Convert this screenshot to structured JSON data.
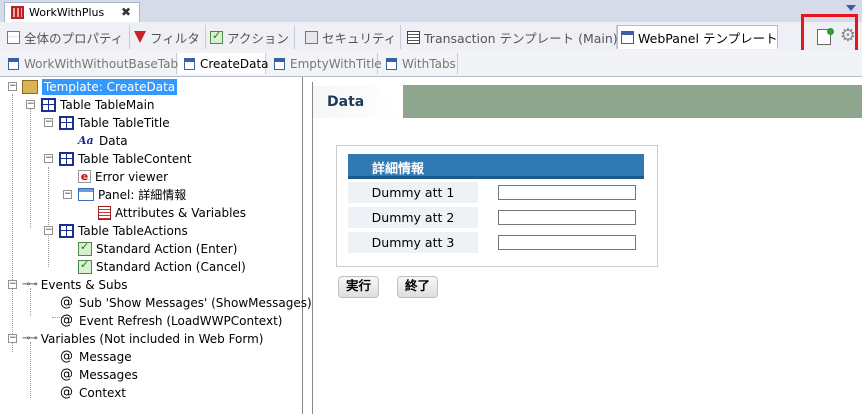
{
  "document_tab": {
    "title": "WorkWithPlus",
    "close": "✖"
  },
  "editor_tabs": [
    {
      "label": "全体のプロパティ"
    },
    {
      "label": "フィルタ"
    },
    {
      "label": "アクション"
    },
    {
      "label": "セキュリティ"
    },
    {
      "label": "Transaction テンプレート (Main)"
    },
    {
      "label": "WebPanel テンプレート"
    }
  ],
  "toolbar": {
    "new_icon": "new-document-icon",
    "settings_icon": "gear-icon",
    "highlight_color": "#e8141c"
  },
  "sub_tabs": [
    {
      "label": "WorkWithWithoutBaseTable"
    },
    {
      "label": "CreateData"
    },
    {
      "label": "EmptyWithTitle"
    },
    {
      "label": "WithTabs"
    }
  ],
  "tree": {
    "root": "Template: CreateData",
    "table_main": "Table TableMain",
    "table_title": "Table TableTitle",
    "text_icon": "Aa",
    "data": "Data",
    "table_content": "Table TableContent",
    "error_icon": "e",
    "error_viewer": "Error viewer",
    "panel": "Panel: 詳細情報",
    "attributes": "Attributes & Variables",
    "table_actions": "Table TableActions",
    "action_enter": "Standard Action (Enter)",
    "action_cancel": "Standard Action (Cancel)",
    "events": "Events & Subs",
    "sub_show": "Sub 'Show Messages' (ShowMessages)",
    "event_refresh": "Event Refresh (LoadWWPContext)",
    "variables": "Variables (Not included in Web Form)",
    "var_message": "Message",
    "var_messages": "Messages",
    "var_context": "Context",
    "at": "@",
    "evt_glyph": "⊸⊸"
  },
  "design": {
    "tab_title": "Data",
    "panel_title": "詳細情報",
    "rows": [
      "Dummy att 1",
      "Dummy att 2",
      "Dummy att 3"
    ],
    "buttons": {
      "run": "実行",
      "end": "終了"
    },
    "header_color": "#2f79b4"
  }
}
